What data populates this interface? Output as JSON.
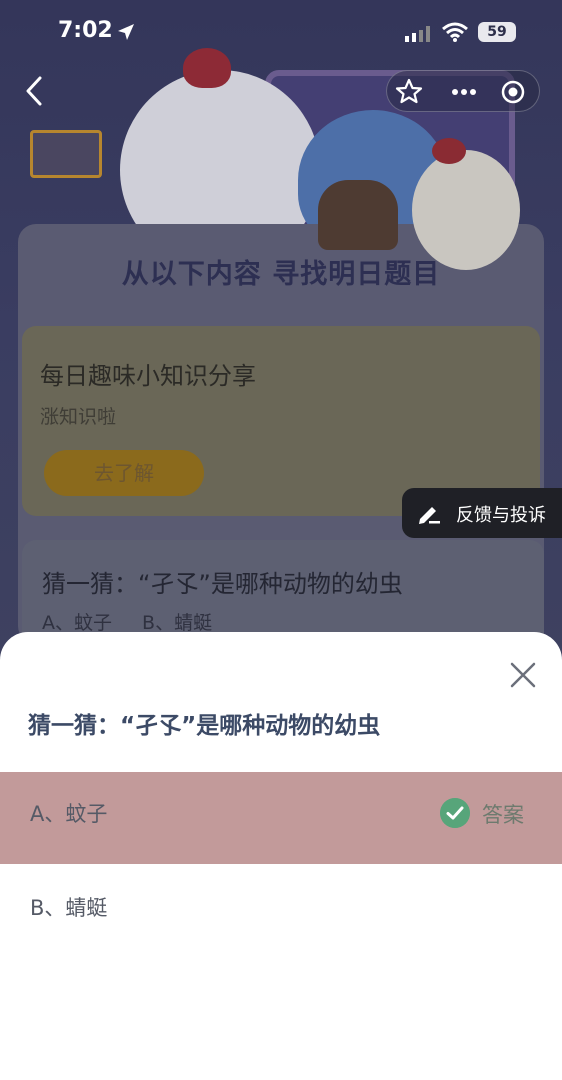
{
  "status_bar": {
    "time": "7:02",
    "battery": "59"
  },
  "background": {
    "heading": "从以下内容  寻找明日题目",
    "fact_card": {
      "title": "每日趣味小知识分享",
      "subtitle": "涨知识啦",
      "button": "去了解"
    },
    "question_card": {
      "title": "猜一猜：“孑孓”是哪种动物的幼虫",
      "options_preview": "A、蚊子 B、蜻蜓"
    },
    "feedback_label": "反馈与投诉"
  },
  "sheet": {
    "question": "猜一猜：“孑孓”是哪种动物的幼虫",
    "options": [
      {
        "label": "A、蚊子",
        "is_answer": true,
        "tag": "答案"
      },
      {
        "label": "B、蜻蜓",
        "is_answer": false
      }
    ]
  },
  "colors": {
    "answer_highlight": "#c29a9a",
    "answer_check": "#57a57a",
    "question_text": "#3c4a66"
  }
}
